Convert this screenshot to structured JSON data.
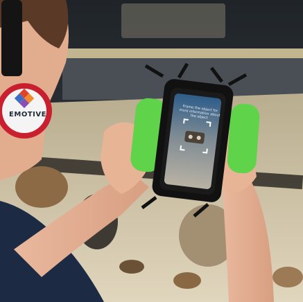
{
  "headphone": {
    "brand": "EMOTIVE"
  },
  "phone": {
    "caption": "Frame the object for more information about the object"
  },
  "colors": {
    "handle_green": "#5fd34a",
    "headphone_red": "#c9202f",
    "shirt_navy": "#1c2a44",
    "case_table": "#cfc3a2"
  }
}
